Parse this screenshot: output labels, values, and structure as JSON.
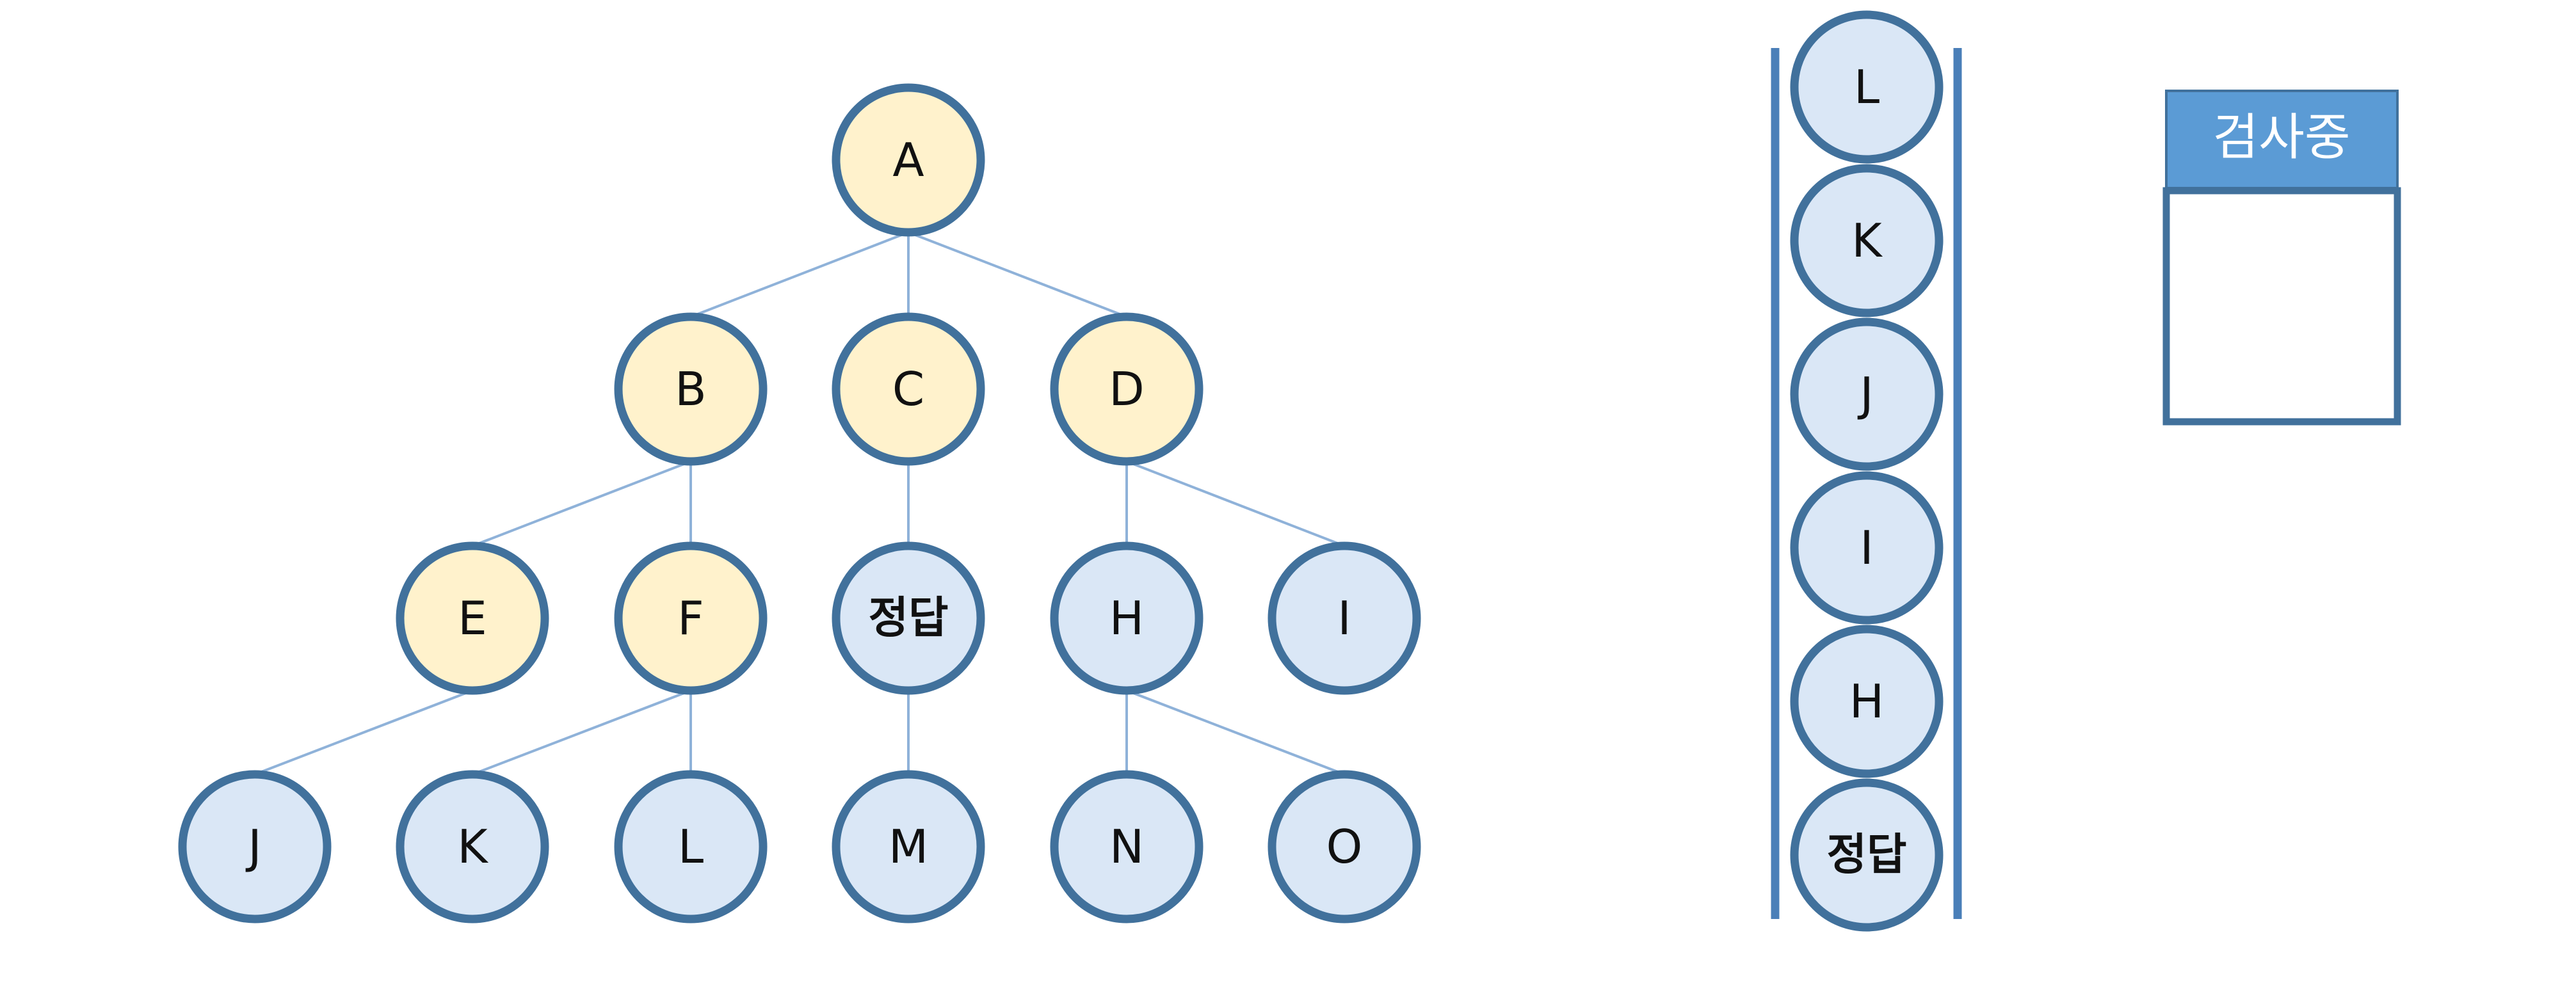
{
  "colors": {
    "stroke": "#41719c",
    "edge": "#8fb2d9",
    "visited_fill": "#fff2cc",
    "unvisited_fill": "#dae7f6",
    "header_fill": "#5b9bd5",
    "header_text": "#ffffff",
    "stack_wall": "#4a7fb8"
  },
  "tree": {
    "nodes": [
      {
        "id": "A",
        "label": "A",
        "visited": true
      },
      {
        "id": "B",
        "label": "B",
        "visited": true
      },
      {
        "id": "C",
        "label": "C",
        "visited": true
      },
      {
        "id": "D",
        "label": "D",
        "visited": true
      },
      {
        "id": "E",
        "label": "E",
        "visited": true
      },
      {
        "id": "F",
        "label": "F",
        "visited": true
      },
      {
        "id": "G",
        "label": "정답",
        "visited": false,
        "bold": true
      },
      {
        "id": "H",
        "label": "H",
        "visited": false
      },
      {
        "id": "I",
        "label": "I",
        "visited": false
      },
      {
        "id": "J",
        "label": "J",
        "visited": false
      },
      {
        "id": "K",
        "label": "K",
        "visited": false
      },
      {
        "id": "L",
        "label": "L",
        "visited": false
      },
      {
        "id": "M",
        "label": "M",
        "visited": false
      },
      {
        "id": "N",
        "label": "N",
        "visited": false
      },
      {
        "id": "O",
        "label": "O",
        "visited": false
      }
    ],
    "edges": [
      [
        "A",
        "B"
      ],
      [
        "A",
        "C"
      ],
      [
        "A",
        "D"
      ],
      [
        "B",
        "E"
      ],
      [
        "B",
        "F"
      ],
      [
        "C",
        "G"
      ],
      [
        "D",
        "H"
      ],
      [
        "D",
        "I"
      ],
      [
        "E",
        "J"
      ],
      [
        "F",
        "K"
      ],
      [
        "F",
        "L"
      ],
      [
        "G",
        "M"
      ],
      [
        "H",
        "N"
      ],
      [
        "H",
        "O"
      ]
    ]
  },
  "stack": {
    "items_top_to_bottom": [
      {
        "label": "L"
      },
      {
        "label": "K"
      },
      {
        "label": "J"
      },
      {
        "label": "I"
      },
      {
        "label": "H"
      },
      {
        "label": "정답",
        "bold": true
      }
    ]
  },
  "checking": {
    "title": "검사중",
    "content": ""
  }
}
